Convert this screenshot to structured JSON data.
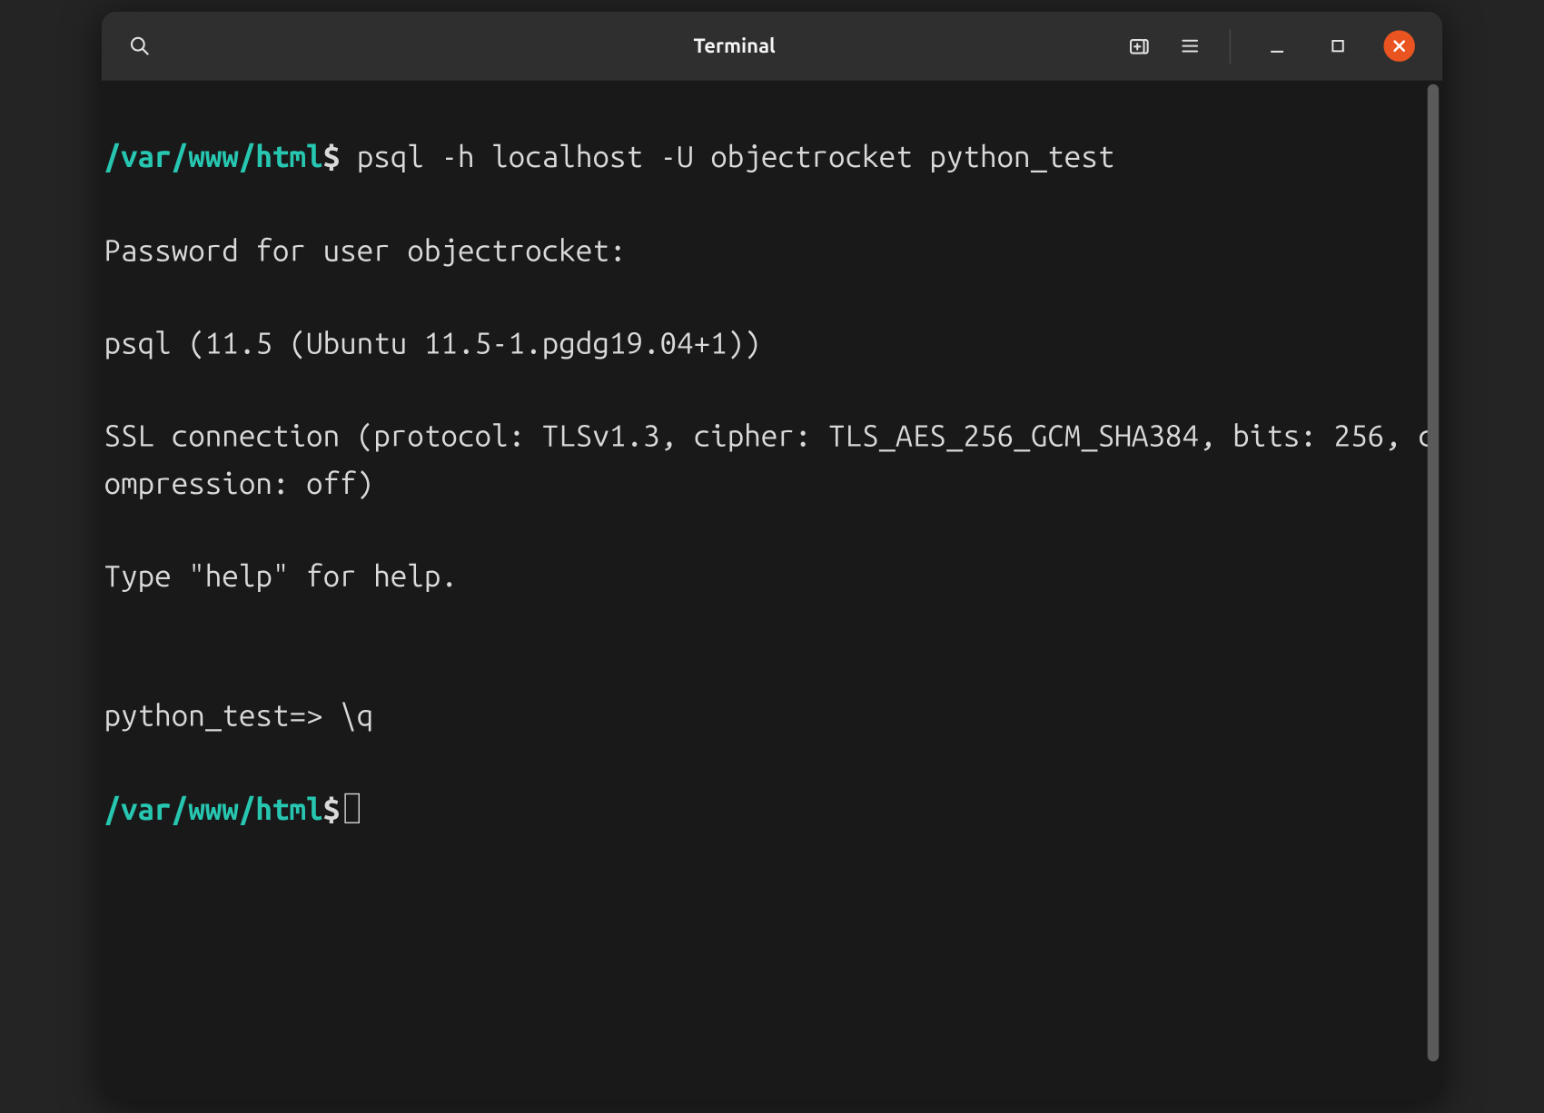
{
  "window": {
    "title": "Terminal"
  },
  "terminal": {
    "lines": [
      {
        "prompt_path": "/var/www/html",
        "prompt_symbol": "$",
        "command": " psql -h localhost -U objectrocket python_test"
      }
    ],
    "output": {
      "l1": "Password for user objectrocket:",
      "l2": "psql (11.5 (Ubuntu 11.5-1.pgdg19.04+1))",
      "l3": "SSL connection (protocol: TLSv1.3, cipher: TLS_AES_256_GCM_SHA384, bits: 256, compression: off)",
      "l4": "Type \"help\" for help.",
      "blank": "",
      "psql_prompt": "python_test=> ",
      "psql_cmd": "\\q"
    },
    "second_prompt": {
      "path": "/var/www/html",
      "symbol": "$"
    }
  }
}
